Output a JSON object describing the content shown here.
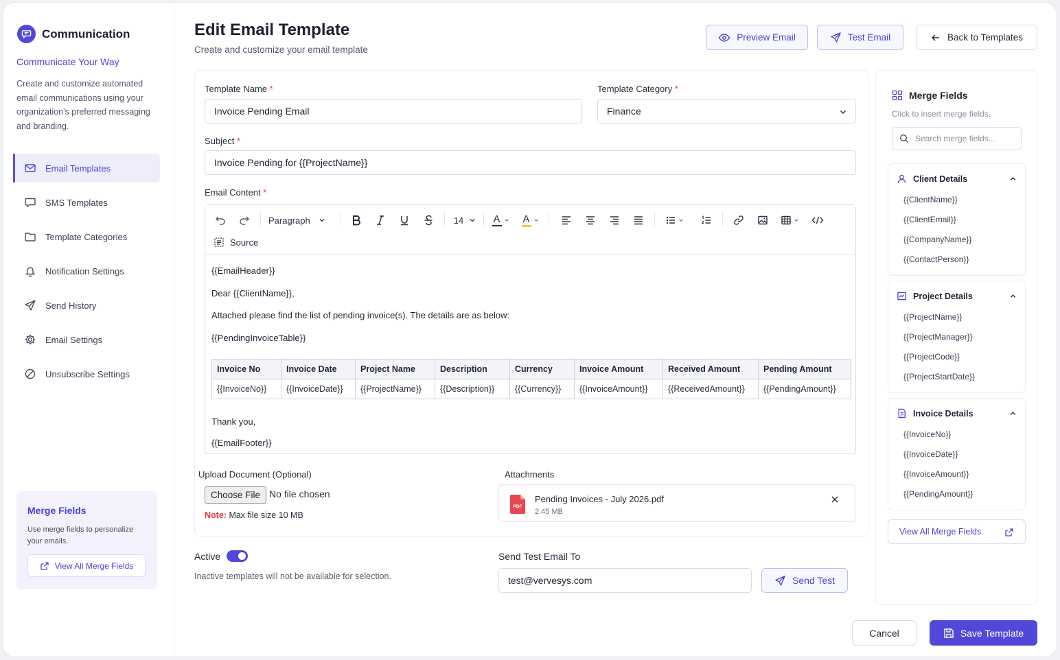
{
  "sidebar": {
    "brand": "Communication",
    "tagline": "Communicate Your Way",
    "description": "Create and customize automated email communications using your organization's preferred messaging and branding.",
    "nav": [
      {
        "label": "Email Templates",
        "icon": "mail-icon",
        "active": true
      },
      {
        "label": "SMS Templates",
        "icon": "chat-icon"
      },
      {
        "label": "Template Categories",
        "icon": "folder-icon"
      },
      {
        "label": "Notification Settings",
        "icon": "bell-icon"
      },
      {
        "label": "Send History",
        "icon": "send-icon"
      },
      {
        "label": "Email Settings",
        "icon": "gear-icon"
      },
      {
        "label": "Unsubscribe Settings",
        "icon": "ban-icon"
      }
    ],
    "card": {
      "title": "Merge Fields",
      "description": "Use merge fields to personalize your emails.",
      "button": "View All Merge Fields"
    }
  },
  "header": {
    "title": "Edit Email Template",
    "subtitle": "Create and customize your email template",
    "preview": "Preview Email",
    "test": "Test Email",
    "back": "Back to Templates"
  },
  "form": {
    "name_label": "Template Name",
    "name_value": "Invoice Pending Email",
    "category_label": "Template Category",
    "category_value": "Finance",
    "subject_label": "Subject",
    "subject_value": "Invoice Pending for {{ProjectName}}",
    "content_label": "Email Content",
    "required_mark": "*"
  },
  "toolbar": {
    "paragraph": "Paragraph",
    "font_size": "14",
    "source": "Source",
    "letter_a": "A"
  },
  "content": {
    "header": "{{EmailHeader}}",
    "greeting": "Dear {{ClientName}},",
    "intro": "Attached please find the list of pending invoice(s). The details are as below:",
    "table_tag": "{{PendingInvoiceTable}}",
    "table_headers": [
      "Invoice No",
      "Invoice Date",
      "Project Name",
      "Description",
      "Currency",
      "Invoice Amount",
      "Received Amount",
      "Pending Amount"
    ],
    "table_row": [
      "{{InvoiceNo}}",
      "{{InvoiceDate}}",
      "{{ProjectName}}",
      "{{Description}}",
      "{{Currency}}",
      "{{InvoiceAmount}}",
      "{{ReceivedAmount}}",
      "{{PendingAmount}}"
    ],
    "closing": "Thank you,",
    "footer": "{{EmailFooter}}"
  },
  "upload": {
    "label": "Upload Document (Optional)",
    "choose": "Choose File",
    "none": "No file chosen",
    "note_label": "Note:",
    "note_text": "Max file size 10 MB"
  },
  "attachments": {
    "label": "Attachments",
    "file_name": "Pending Invoices - July 2026.pdf",
    "file_size": "2.45 MB",
    "file_badge": "PDF"
  },
  "active": {
    "label": "Active",
    "on": true,
    "help": "Inactive templates will not be available for selection."
  },
  "test_email": {
    "label": "Send Test Email To",
    "value": "test@vervesys.com",
    "button": "Send Test"
  },
  "merge_panel": {
    "title": "Merge Fields",
    "subtitle": "Click to insert merge fields.",
    "search_placeholder": "Search merge fields...",
    "groups": [
      {
        "title": "Client Details",
        "icon": "user-icon",
        "items": [
          "{{ClientName}}",
          "{{ClientEmail}}",
          "{{CompanyName}}",
          "{{ContactPerson}}"
        ]
      },
      {
        "title": "Project Details",
        "icon": "project-icon",
        "items": [
          "{{ProjectName}}",
          "{{ProjectManager}}",
          "{{ProjectCode}}",
          "{{ProjectStartDate}}"
        ]
      },
      {
        "title": "Invoice Details",
        "icon": "invoice-icon",
        "items": [
          "{{InvoiceNo}}",
          "{{InvoiceDate}}",
          "{{InvoiceAmount}}",
          "{{PendingAmount}}"
        ]
      }
    ],
    "view_all": "View All Merge Fields"
  },
  "footer_actions": {
    "cancel": "Cancel",
    "save": "Save Template"
  },
  "colors": {
    "accent": "#5048d9",
    "required": "#e23b3b",
    "pdf": "#e5484d"
  }
}
